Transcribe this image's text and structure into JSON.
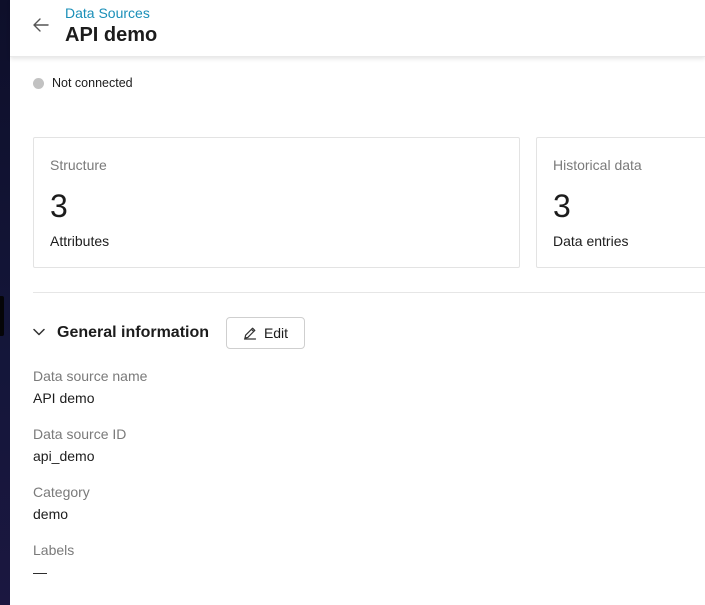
{
  "header": {
    "breadcrumb": "Data Sources",
    "title": "API demo",
    "back_icon": "arrow-left-icon"
  },
  "status": {
    "label": "Not connected",
    "dot_color": "#c2c2c2"
  },
  "cards": [
    {
      "label": "Structure",
      "value": "3",
      "sublabel": "Attributes"
    },
    {
      "label": "Historical data",
      "value": "3",
      "sublabel": "Data entries"
    }
  ],
  "general_info": {
    "title": "General information",
    "toggle_icon": "chevron-down-icon",
    "edit_label": "Edit",
    "edit_icon": "pencil-icon",
    "fields": [
      {
        "label": "Data source name",
        "value": "API demo"
      },
      {
        "label": "Data source ID",
        "value": "api_demo"
      },
      {
        "label": "Category",
        "value": "demo"
      },
      {
        "label": "Labels",
        "value": "—"
      }
    ]
  },
  "colors": {
    "accent": "#1a8fb8",
    "text": "#1c1c1c",
    "muted": "#7a7a7a"
  }
}
